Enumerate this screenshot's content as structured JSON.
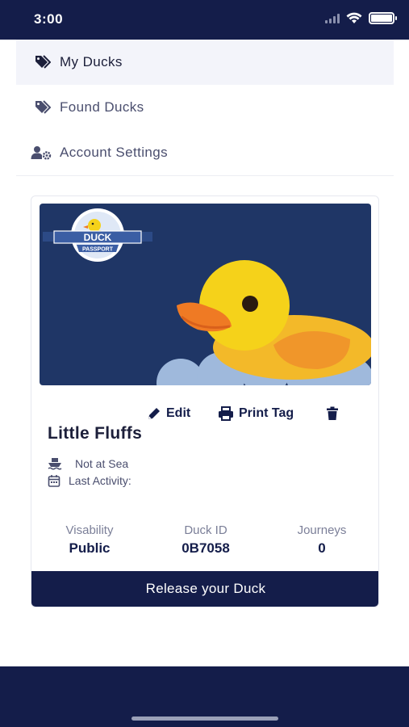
{
  "status": {
    "time": "3:00"
  },
  "menu": {
    "items": [
      {
        "label": "My Ducks",
        "icon": "tags-icon",
        "active": true
      },
      {
        "label": "Found Ducks",
        "icon": "tags-icon",
        "active": false
      },
      {
        "label": "Account Settings",
        "icon": "user-cog-icon",
        "active": false
      }
    ]
  },
  "card": {
    "logo": {
      "line1": "DUCK",
      "line2": "PASSPORT"
    },
    "actions": {
      "edit": "Edit",
      "print": "Print Tag"
    },
    "name": "Little Fluffs",
    "status": "Not at Sea",
    "last_activity": "Last Activity:",
    "stats": [
      {
        "label": "Visability",
        "value": "Public"
      },
      {
        "label": "Duck ID",
        "value": "0B7058"
      },
      {
        "label": "Journeys",
        "value": "0"
      }
    ],
    "release_label": "Release your Duck"
  },
  "colors": {
    "navy": "#141d4a",
    "banner": "#1f3666",
    "duck": "#f5d21a",
    "beak": "#ef7a24"
  }
}
